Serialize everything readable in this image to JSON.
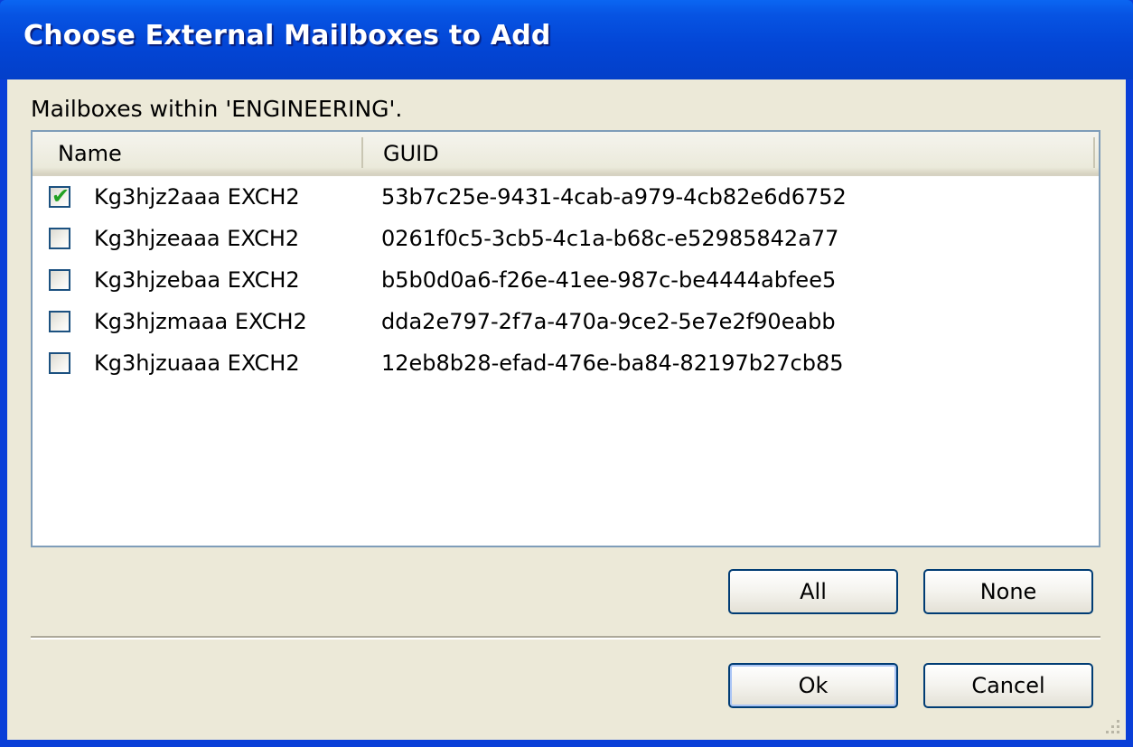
{
  "dialog": {
    "title": "Choose External Mailboxes to Add",
    "subtitle": "Mailboxes within 'ENGINEERING'."
  },
  "list": {
    "columns": [
      "Name",
      "GUID"
    ],
    "rows": [
      {
        "checked": true,
        "name": "Kg3hjz2aaa EXCH2",
        "guid": "53b7c25e-9431-4cab-a979-4cb82e6d6752"
      },
      {
        "checked": false,
        "name": "Kg3hjzeaaa EXCH2",
        "guid": "0261f0c5-3cb5-4c1a-b68c-e52985842a77"
      },
      {
        "checked": false,
        "name": "Kg3hjzebaa EXCH2",
        "guid": "b5b0d0a6-f26e-41ee-987c-be4444abfee5"
      },
      {
        "checked": false,
        "name": "Kg3hjzmaaa EXCH2",
        "guid": "dda2e797-2f7a-470a-9ce2-5e7e2f90eabb"
      },
      {
        "checked": false,
        "name": "Kg3hjzuaaa EXCH2",
        "guid": "12eb8b28-efad-476e-ba84-82197b27cb85"
      }
    ]
  },
  "buttons": {
    "all": "All",
    "none": "None",
    "ok": "Ok",
    "cancel": "Cancel"
  },
  "colors": {
    "titlebar": "#0346d6",
    "client_bg": "#ece9d8",
    "check": "#21a121"
  }
}
